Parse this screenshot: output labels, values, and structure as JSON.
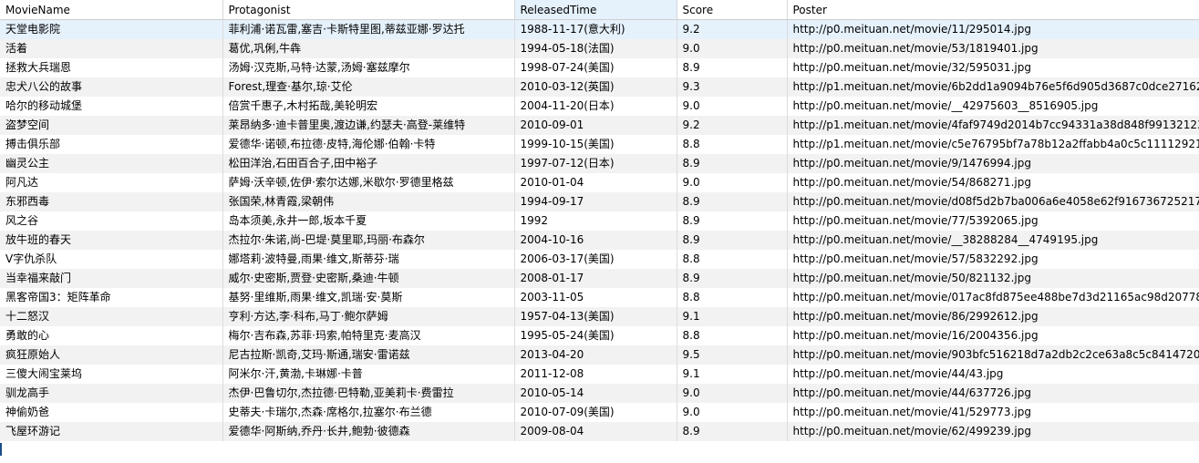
{
  "columns": [
    "MovieName",
    "Protagonist",
    "ReleasedTime",
    "Score",
    "Poster"
  ],
  "rows": [
    [
      "天堂电影院",
      "菲利浦·诺瓦雷,塞吉·卡斯特里图,蒂兹亚娜·罗达托",
      "1988-11-17(意大利)",
      "9.2",
      "http://p0.meituan.net/movie/11/295014.jpg"
    ],
    [
      "活着",
      "葛优,巩俐,牛犇",
      "1994-05-18(法国)",
      "9.0",
      "http://p0.meituan.net/movie/53/1819401.jpg"
    ],
    [
      "拯救大兵瑞恩",
      "汤姆·汉克斯,马特·达蒙,汤姆·塞兹摩尔",
      "1998-07-24(美国)",
      "8.9",
      "http://p0.meituan.net/movie/32/595031.jpg"
    ],
    [
      "忠犬八公的故事",
      "Forest,理查·基尔,琼·艾伦",
      "2010-03-12(英国)",
      "9.3",
      "http://p1.meituan.net/movie/6b2dd1a9094b76e5f6d905d3687c0dce27162.jpg"
    ],
    [
      "哈尔的移动城堡",
      "倍赏千惠子,木村拓哉,美轮明宏",
      "2004-11-20(日本)",
      "9.0",
      "http://p0.meituan.net/movie/__42975603__8516905.jpg"
    ],
    [
      "盗梦空间",
      "莱昂纳多·迪卡普里奥,渡边谦,约瑟夫·高登-莱维特",
      "2010-09-01",
      "9.2",
      "http://p1.meituan.net/movie/4faf9749d2014b7cc94331a38d848f99132123.jpg"
    ],
    [
      "搏击俱乐部",
      "爱德华·诺顿,布拉德·皮特,海伦娜·伯翰·卡特",
      "1999-10-15(美国)",
      "8.8",
      "http://p1.meituan.net/movie/c5e76795bf7a78b12a2ffabb4a0c5c11112921.jpg"
    ],
    [
      "幽灵公主",
      "松田洋治,石田百合子,田中裕子",
      "1997-07-12(日本)",
      "8.9",
      "http://p0.meituan.net/movie/9/1476994.jpg"
    ],
    [
      "阿凡达",
      "萨姆·沃辛顿,佐伊·索尔达娜,米歇尔·罗德里格兹",
      "2010-01-04",
      "9.0",
      "http://p0.meituan.net/movie/54/868271.jpg"
    ],
    [
      "东邪西毒",
      "张国荣,林青霞,梁朝伟",
      "1994-09-17",
      "8.9",
      "http://p0.meituan.net/movie/d08f5d2b7ba006a6e4058e62f916736725217.jpg"
    ],
    [
      "风之谷",
      "岛本须美,永井一郎,坂本千夏",
      "1992",
      "8.9",
      "http://p0.meituan.net/movie/77/5392065.jpg"
    ],
    [
      "放牛班的春天",
      "杰拉尔·朱诺,尚-巴堤·莫里耶,玛丽·布森尔",
      "2004-10-16",
      "8.9",
      "http://p0.meituan.net/movie/__38288284__4749195.jpg"
    ],
    [
      "V字仇杀队",
      "娜塔莉·波特曼,雨果·维文,斯蒂芬·瑞",
      "2006-03-17(美国)",
      "8.8",
      "http://p0.meituan.net/movie/57/5832292.jpg"
    ],
    [
      "当幸福来敲门",
      "威尔·史密斯,贾登·史密斯,桑迪·牛顿",
      "2008-01-17",
      "8.9",
      "http://p0.meituan.net/movie/50/821132.jpg"
    ],
    [
      "黑客帝国3：矩阵革命",
      "基努·里维斯,雨果·维文,凯瑞·安·莫斯",
      "2003-11-05",
      "8.8",
      "http://p0.meituan.net/movie/017ac8fd875ee488be7d3d21165ac98d20778.jpg"
    ],
    [
      "十二怒汉",
      "亨利·方达,李·科布,马丁·鲍尔萨姆",
      "1957-04-13(美国)",
      "9.1",
      "http://p0.meituan.net/movie/86/2992612.jpg"
    ],
    [
      "勇敢的心",
      "梅尔·吉布森,苏菲·玛索,帕特里克·麦高汉",
      "1995-05-24(美国)",
      "8.8",
      "http://p0.meituan.net/movie/16/2004356.jpg"
    ],
    [
      "疯狂原始人",
      "尼古拉斯·凯奇,艾玛·斯通,瑞安·雷诺兹",
      "2013-04-20",
      "9.5",
      "http://p0.meituan.net/movie/903bfc516218d7a2db2c2ce63a8c5c84147205.jpg"
    ],
    [
      "三傻大闹宝莱坞",
      "阿米尔·汗,黄渤,卡琳娜·卡普",
      "2011-12-08",
      "9.1",
      "http://p0.meituan.net/movie/44/43.jpg"
    ],
    [
      "驯龙高手",
      "杰伊·巴鲁切尔,杰拉德·巴特勒,亚美莉卡·费雷拉",
      "2010-05-14",
      "9.0",
      "http://p0.meituan.net/movie/44/637726.jpg"
    ],
    [
      "神偷奶爸",
      "史蒂夫·卡瑞尔,杰森·席格尔,拉塞尔·布兰德",
      "2010-07-09(美国)",
      "9.0",
      "http://p0.meituan.net/movie/41/529773.jpg"
    ],
    [
      "飞屋环游记",
      "爱德华·阿斯纳,乔丹·长井,鲍勃·彼德森",
      "2009-08-04",
      "8.9",
      "http://p0.meituan.net/movie/62/499239.jpg"
    ]
  ]
}
